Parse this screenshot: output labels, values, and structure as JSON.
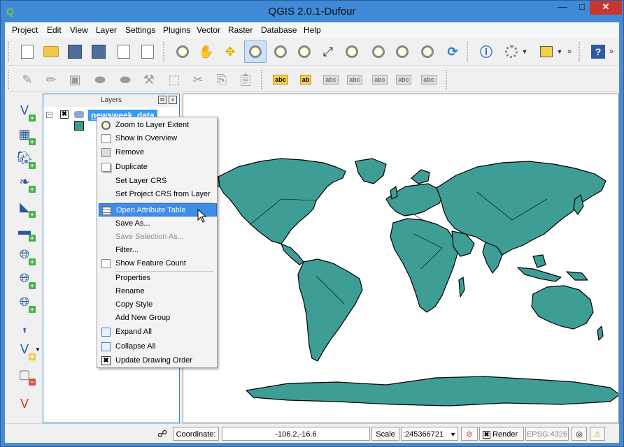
{
  "window": {
    "title": "QGIS 2.0.1-Dufour",
    "minimize": "—",
    "maximize": "□",
    "close": "✕"
  },
  "menu": [
    "Project",
    "Edit",
    "View",
    "Layer",
    "Settings",
    "Plugins",
    "Vector",
    "Raster",
    "Database",
    "Help"
  ],
  "layers_panel": {
    "title": "Layers",
    "layer_name": "newsweek_data",
    "checked": "✖",
    "expander": "−"
  },
  "context_menu": {
    "items": [
      {
        "label": "Zoom to Layer Extent",
        "icon": "zoom-icon"
      },
      {
        "label": "Show in Overview",
        "icon": "checkbox-icon"
      },
      {
        "label": "Remove",
        "icon": "remove-icon"
      },
      {
        "label": "Duplicate",
        "icon": "duplicate-icon"
      },
      {
        "label": "Set Layer CRS"
      },
      {
        "label": "Set Project CRS from Layer"
      },
      {
        "label": "Open Attribute Table",
        "icon": "table-icon",
        "highlighted": true
      },
      {
        "label": "Save As..."
      },
      {
        "label": "Save Selection As...",
        "disabled": true
      },
      {
        "label": "Filter..."
      },
      {
        "label": "Show Feature Count",
        "icon": "checkbox-icon"
      },
      {
        "label": "Properties"
      },
      {
        "label": "Rename"
      },
      {
        "label": "Copy Style"
      },
      {
        "label": "Add New Group"
      },
      {
        "label": "Expand All",
        "icon": "expand-icon"
      },
      {
        "label": "Collapse All",
        "icon": "collapse-icon"
      },
      {
        "label": "Update Drawing Order",
        "icon": "checkmark-icon"
      }
    ]
  },
  "status": {
    "coordinate_label": "Coordinate:",
    "coordinate_value": "-106.2,-16.6",
    "scale_label": "Scale",
    "scale_value": ":245366721",
    "render_label": "Render",
    "render_checked": "✖",
    "crs": "EPSG:4326"
  },
  "colors": {
    "map_fill": "#3e9e96",
    "selection": "#3399ff",
    "title_bar": "#3f89d6"
  }
}
